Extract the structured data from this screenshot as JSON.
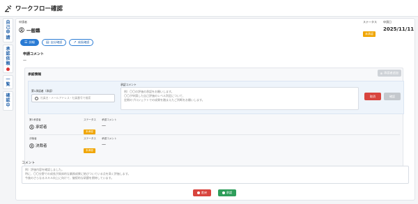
{
  "page": {
    "title": "ワークフロー確認"
  },
  "sidebar": {
    "tabs": [
      {
        "label": "自己申請",
        "active": false,
        "dot": false
      },
      {
        "label": "承認依頼",
        "active": true,
        "dot": true
      },
      {
        "label": "一覧",
        "active": false,
        "dot": false
      },
      {
        "label": "確認中",
        "active": false,
        "dot": false
      }
    ]
  },
  "header": {
    "applicant_label": "申請者",
    "applicant_name": "一般職",
    "status_label": "ステータス",
    "status_value": "未承認",
    "date_label": "申請日",
    "date_value": "2025/11/11"
  },
  "tabs": [
    {
      "label": "詳細",
      "icon": "list-icon"
    },
    {
      "label": "自分確認",
      "icon": "document-icon"
    },
    {
      "label": "成長確認",
      "icon": "trend-icon"
    }
  ],
  "application_comment": {
    "label": "申請コメント",
    "value": "—"
  },
  "approval_info": {
    "title": "承認情報",
    "add_button": "承認者追加",
    "editing": {
      "approver_label": "第1承認者（承認）",
      "search_placeholder": "社員名・メールアドレス・社員番号で検索",
      "comment_label": "承認コメント",
      "comment_placeholder_lines": [
        "例）〇〇の評価の承認をお願いします。",
        "〇〇が申請した自己評価のレベル判定について、",
        "定期のプロジェクトでの成果を踏まえたご判断をお願いします。"
      ],
      "cancel_label": "取消",
      "confirm_label": "確認"
    },
    "approvers": [
      {
        "stage_label": "第1承認者",
        "name": "承認者",
        "status_label": "ステータス",
        "status": "未承認",
        "comment_label": "承認コメント",
        "comment": "—"
      },
      {
        "stage_label": "決裁者",
        "name": "決裁者",
        "status_label": "ステータス",
        "status": "未承認",
        "comment_label": "承認コメント",
        "comment": "—"
      }
    ]
  },
  "comment": {
    "label": "コメント",
    "placeholder_lines": [
      "例）評価内容を確認しました。",
      "特に、〇〇分野での成長が具体的な業務成果に結びついている点を高く評価します。",
      "今後のさらなるスキル向上に向けて、継続的な研鑽を期待しています。"
    ]
  },
  "actions": {
    "reject_label": "差戻",
    "approve_label": "承認"
  },
  "colors": {
    "accent": "#2a7bd4",
    "warning": "#f0a500",
    "danger": "#d8453e",
    "success": "#2f9e5b"
  }
}
